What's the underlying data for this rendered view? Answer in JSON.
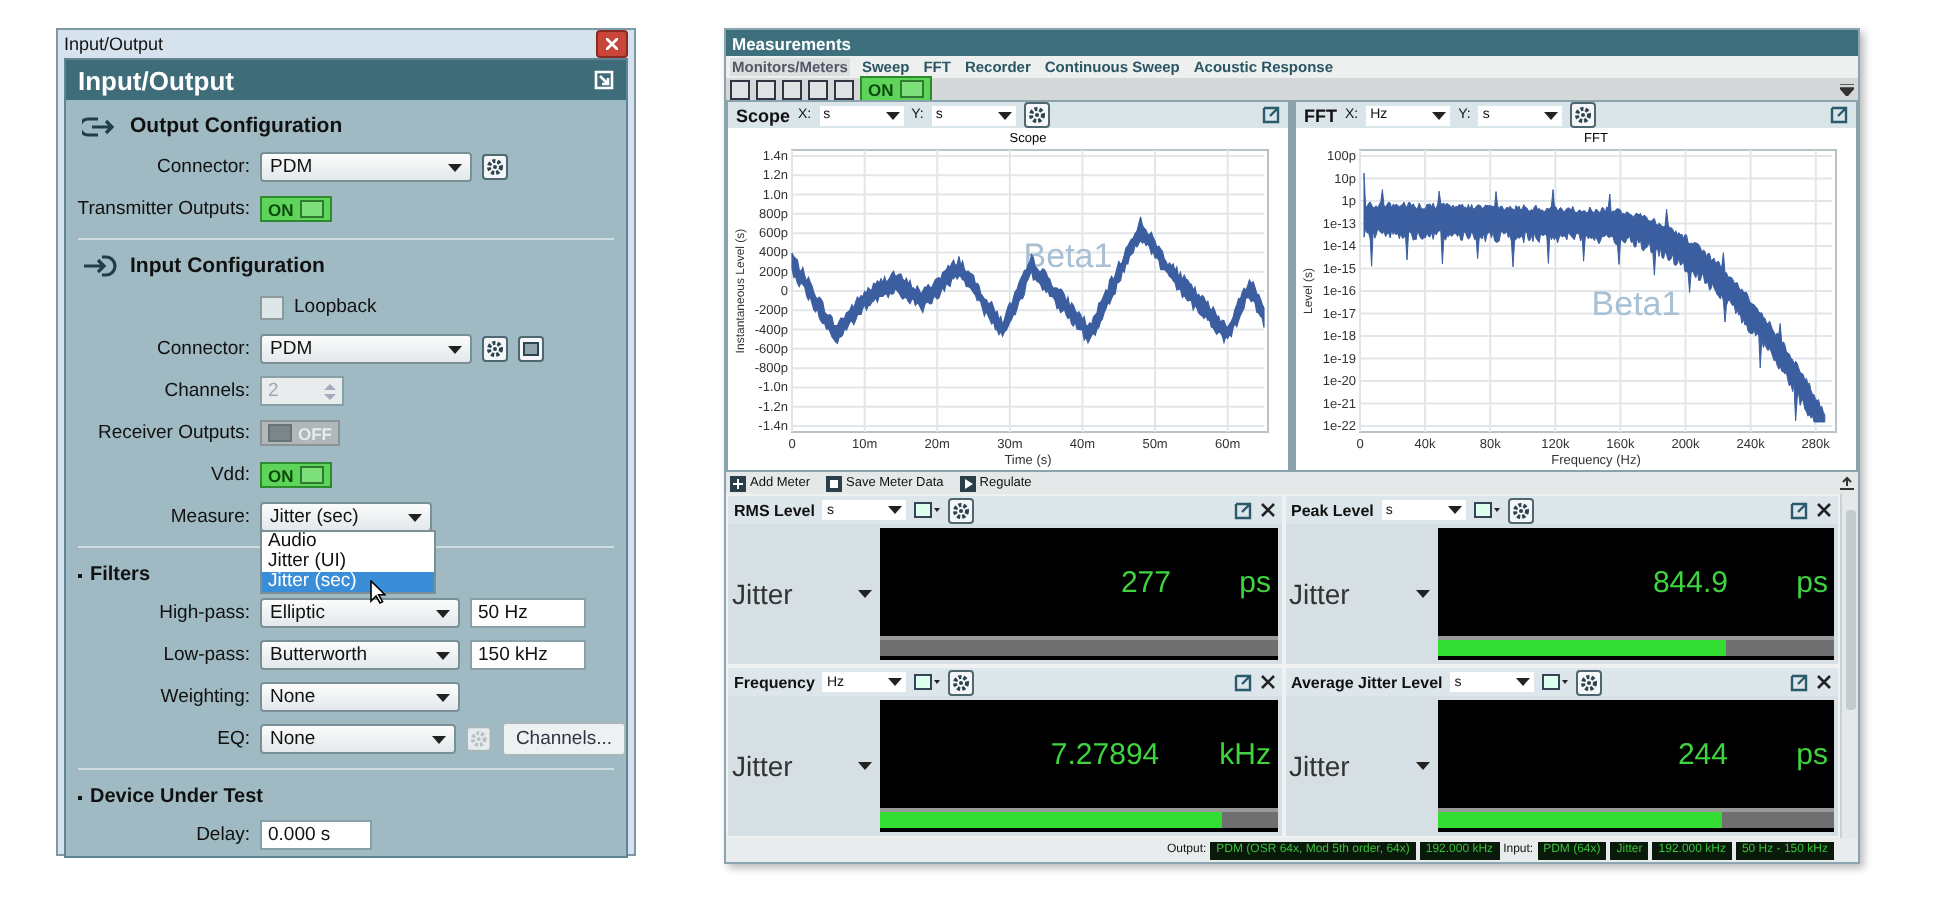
{
  "io_window": {
    "title": "Input/Output",
    "panel_title": "Input/Output",
    "output_config": {
      "heading": "Output Configuration",
      "connector": {
        "label": "Connector:",
        "value": "PDM"
      },
      "transmitter_outputs": {
        "label": "Transmitter Outputs:",
        "on": true,
        "text": "ON"
      }
    },
    "input_config": {
      "heading": "Input Configuration",
      "loopback": {
        "label": "Loopback",
        "checked": false
      },
      "connector": {
        "label": "Connector:",
        "value": "PDM"
      },
      "channels": {
        "label": "Channels:",
        "value": "2",
        "disabled": true
      },
      "receiver_outputs": {
        "label": "Receiver Outputs:",
        "on": false,
        "text": "OFF"
      },
      "vdd": {
        "label": "Vdd:",
        "on": true,
        "text": "ON"
      },
      "measure": {
        "label": "Measure:",
        "value": "Jitter (sec)",
        "options": [
          {
            "label": "Audio",
            "selected": false
          },
          {
            "label": "Jitter (UI)",
            "selected": false
          },
          {
            "label": "Jitter (sec)",
            "selected": true
          }
        ]
      }
    },
    "filters": {
      "heading": "Filters",
      "rows": [
        {
          "label": "High-pass:",
          "value": "Elliptic",
          "frequency": "50 Hz"
        },
        {
          "label": "Low-pass:",
          "value": "Butterworth",
          "frequency": "150 kHz"
        },
        {
          "label": "Weighting:",
          "value": "None"
        },
        {
          "label": "EQ:",
          "value": "None",
          "button": "Channels..."
        }
      ]
    },
    "dut": {
      "heading": "Device Under Test",
      "delay": {
        "label": "Delay:",
        "value": "0.000 s"
      }
    }
  },
  "measurements": {
    "title": "Measurements",
    "tabs": [
      {
        "label": "Monitors/Meters",
        "selected": true
      },
      {
        "label": "Sweep",
        "selected": false
      },
      {
        "label": "FFT",
        "selected": false
      },
      {
        "label": "Recorder",
        "selected": false
      },
      {
        "label": "Continuous Sweep",
        "selected": false
      },
      {
        "label": "Acoustic Response",
        "selected": false
      }
    ],
    "toolbar": {
      "toggle": {
        "on": true,
        "text": "ON"
      }
    },
    "charts": [
      {
        "kind": "scope",
        "title": "Scope",
        "x_label": "X:",
        "x_unit": "s",
        "y_label": "Y:",
        "y_unit": "s",
        "plot_title": "Scope",
        "xlabel": "Time (s)",
        "ylabel": "Instantaneous Level (s)",
        "watermark": "Beta1",
        "xticks": [
          "0",
          "10m",
          "20m",
          "30m",
          "40m",
          "50m",
          "60m"
        ],
        "yticks": [
          "1.4n",
          "1.2n",
          "1.0n",
          "800p",
          "600p",
          "400p",
          "200p",
          "0",
          "-200p",
          "-400p",
          "-600p",
          "-800p",
          "-1.0n",
          "-1.2n",
          "-1.4n"
        ]
      },
      {
        "kind": "fft",
        "title": "FFT",
        "x_label": "X:",
        "x_unit": "Hz",
        "y_label": "Y:",
        "y_unit": "s",
        "plot_title": "FFT",
        "xlabel": "Frequency (Hz)",
        "ylabel": "Level (s)",
        "watermark": "Beta1",
        "xticks": [
          "0",
          "40k",
          "80k",
          "120k",
          "160k",
          "200k",
          "240k",
          "280k"
        ],
        "yticks": [
          "100p",
          "10p",
          "1p",
          "1e-13",
          "1e-14",
          "1e-15",
          "1e-16",
          "1e-17",
          "1e-18",
          "1e-19",
          "1e-20",
          "1e-21",
          "1e-22"
        ]
      }
    ],
    "meter_toolbar": [
      "Add Meter",
      "Save Meter Data",
      "Regulate"
    ],
    "meters": [
      {
        "title": "RMS Level",
        "unit_select": "s",
        "label": "Jitter",
        "value": "277",
        "unit": "ps"
      },
      {
        "title": "Peak Level",
        "unit_select": "s",
        "label": "Jitter",
        "value": "844.9",
        "unit": "ps",
        "level": 0.73
      },
      {
        "title": "Frequency",
        "unit_select": "Hz",
        "label": "Jitter",
        "value": "7.27894",
        "unit": "kHz",
        "level": 0.86
      },
      {
        "title": "Average Jitter Level",
        "unit_select": "s",
        "label": "Jitter",
        "value": "244",
        "unit": "ps",
        "level": 0.72
      }
    ],
    "status_bar": {
      "output_label": "Output:",
      "output_items": [
        "PDM (OSR 64x, Mod 5th order, 64x)",
        "192.000 kHz"
      ],
      "input_label": "Input:",
      "input_items": [
        "PDM (64x)",
        "Jitter",
        "192.000 kHz",
        "50 Hz - 150 kHz"
      ]
    }
  }
}
